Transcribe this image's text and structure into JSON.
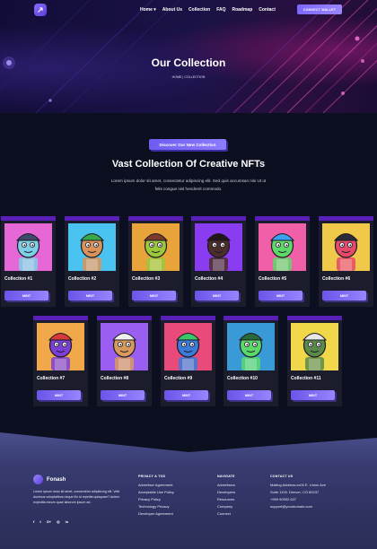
{
  "nav": {
    "links": [
      "Home ▾",
      "About Us",
      "Collection",
      "FAQ",
      "Roadmap",
      "Contact"
    ],
    "wallet_button": "CONNECT WALLET"
  },
  "hero": {
    "title": "Our Collection",
    "breadcrumb": "HOME  |  COLLECTION"
  },
  "section": {
    "pill": "Discover Our New Collection",
    "title": "Vast Collection Of Creative NFTs",
    "description": "Lorem ipsum dolor sit amet, consectetur adipiscing elit. Sed quis accumsan nisi Ut ut felis congue nisl hendrerit commodo."
  },
  "mint_label": "MINT",
  "cards": [
    {
      "name": "Collection #1",
      "bg": "#e667d6",
      "face": "#7ecfe8",
      "hat": "#3d4a6b"
    },
    {
      "name": "Collection #2",
      "bg": "#4ac3f0",
      "face": "#d9935a",
      "hat": "#3aa84a"
    },
    {
      "name": "Collection #3",
      "bg": "#e8a33a",
      "face": "#9bc83a",
      "hat": "#7b3a2a"
    },
    {
      "name": "Collection #4",
      "bg": "#8a3df0",
      "face": "#4b2e2b",
      "hat": "#221616"
    },
    {
      "name": "Collection #5",
      "bg": "#f05fa8",
      "face": "#5fd86a",
      "hat": "#3ba0f0"
    },
    {
      "name": "Collection #6",
      "bg": "#f0c84a",
      "face": "#e64a6a",
      "hat": "#2a2a3a"
    },
    {
      "name": "Collection #7",
      "bg": "#f0a84a",
      "face": "#7b3fd8",
      "hat": "#d83a3a"
    },
    {
      "name": "Collection #8",
      "bg": "#9a5ef0",
      "face": "#d89a5a",
      "hat": "#f0f0f0"
    },
    {
      "name": "Collection #9",
      "bg": "#e84a7a",
      "face": "#3a7ad8",
      "hat": "#3ac86a"
    },
    {
      "name": "Collection #10",
      "bg": "#3a9ad8",
      "face": "#5ad86a",
      "hat": "#2a6a3a"
    },
    {
      "name": "Collection #11",
      "bg": "#f0d84a",
      "face": "#5a8a4a",
      "hat": "#e8e8e8"
    }
  ],
  "footer": {
    "brand": "Fonash",
    "about": "Lorem ipsum dolor sit amet, consectetur adipisicing elit. Velit ducimus voluptatibus neque illo id repellat quisquam? Autem expedita earum quae laborum ipsum ad.",
    "socials": [
      "f",
      "t",
      "G+",
      "◎",
      "in"
    ],
    "columns": [
      {
        "heading": "PRIVACY & TOS",
        "links": [
          "Advertiser Agreement",
          "Acceptable Use Policy",
          "Privacy Policy",
          "Technology Privacy",
          "Developer Agreement"
        ]
      },
      {
        "heading": "NAVIGATE",
        "links": [
          "Advertisers",
          "Developers",
          "Resources",
          "Company",
          "Connect"
        ]
      },
      {
        "heading": "CONTACT US",
        "links": [
          "Mailing Address:xx00 E. Union Ave",
          "Suite 1100. Denver, CO 80237",
          "+999 90932 627",
          "support@yourdomain.com"
        ]
      }
    ]
  },
  "colors": {
    "accent": "#7d68ff",
    "card_top": "#5a1fb8",
    "bg": "#0c0f1f"
  }
}
